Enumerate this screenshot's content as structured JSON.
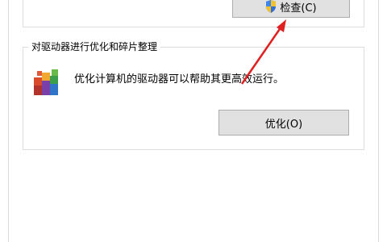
{
  "previous_section": {
    "check_button_label": "检查(C)"
  },
  "optimize_section": {
    "title": "对驱动器进行优化和碎片整理",
    "description": "优化计算机的驱动器可以帮助其更高效运行。",
    "optimize_button_label": "优化(O)"
  },
  "annotation": {
    "arrow_color": "#e02020"
  },
  "icons": [
    "uac-shield-icon",
    "defrag-icon"
  ]
}
